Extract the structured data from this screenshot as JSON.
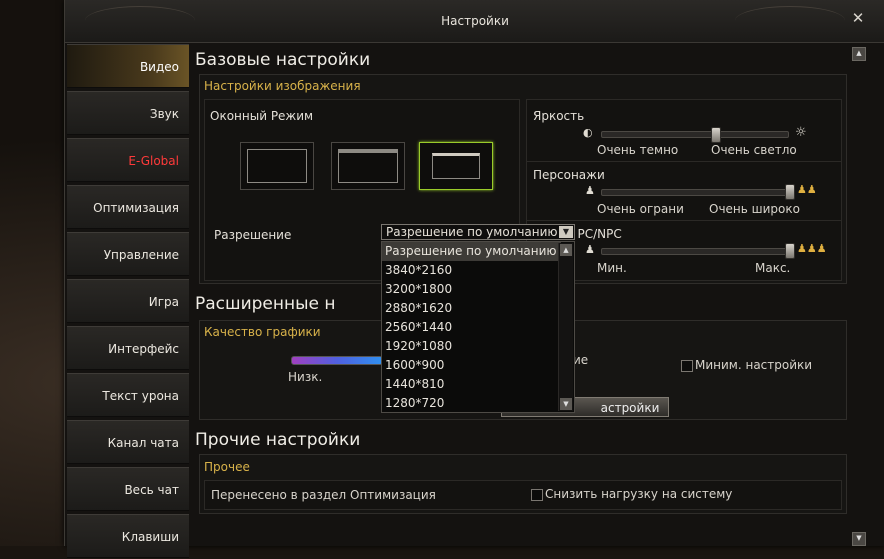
{
  "window": {
    "title": "Настройки"
  },
  "sidebar": {
    "items": [
      {
        "label": "Видео"
      },
      {
        "label": "Звук"
      },
      {
        "label": "E-Global"
      },
      {
        "label": "Оптимизация"
      },
      {
        "label": "Управление"
      },
      {
        "label": "Игра"
      },
      {
        "label": "Интерфейс"
      },
      {
        "label": "Текст урона"
      },
      {
        "label": "Канал чата"
      },
      {
        "label": "Весь чат"
      },
      {
        "label": "Клавиши"
      }
    ]
  },
  "basic": {
    "title": "Базовые настройки",
    "image_group": "Настройки изображения",
    "window_mode": "Оконный Режим",
    "resolution_label": "Разрешение",
    "resolution_value": "Разрешение по умолчанию",
    "resolution_options": [
      "Разрешение по умолчанию",
      "3840*2160",
      "3200*1800",
      "2880*1620",
      "2560*1440",
      "1920*1080",
      "1600*900",
      "1440*810",
      "1280*720"
    ],
    "brightness": {
      "label": "Яркость",
      "min": "Очень темно",
      "max": "Очень светло",
      "value": 0.5
    },
    "characters": {
      "label": "Персонажи",
      "min": "Очень ограни",
      "max": "Очень широко",
      "value": 1.0
    },
    "limit": {
      "label": "Лимит PC/NPC",
      "min": "Мин.",
      "max": "Макс.",
      "value": 1.0
    }
  },
  "advanced": {
    "title": "Расширенные н",
    "quality_group": "Качество графики",
    "low": "Низк.",
    "custom": "ие",
    "min_settings": "Миним. настройки",
    "button": "астройки"
  },
  "other": {
    "title": "Прочие настройки",
    "group": "Прочее",
    "moved": "Перенесено в раздел Оптимизация",
    "reduce_load": "Снизить нагрузку на систему"
  },
  "colors": {
    "accent_gold": "#d8b24a",
    "selected_green": "#9acb2a",
    "red_tab": "#ff3a3a"
  }
}
